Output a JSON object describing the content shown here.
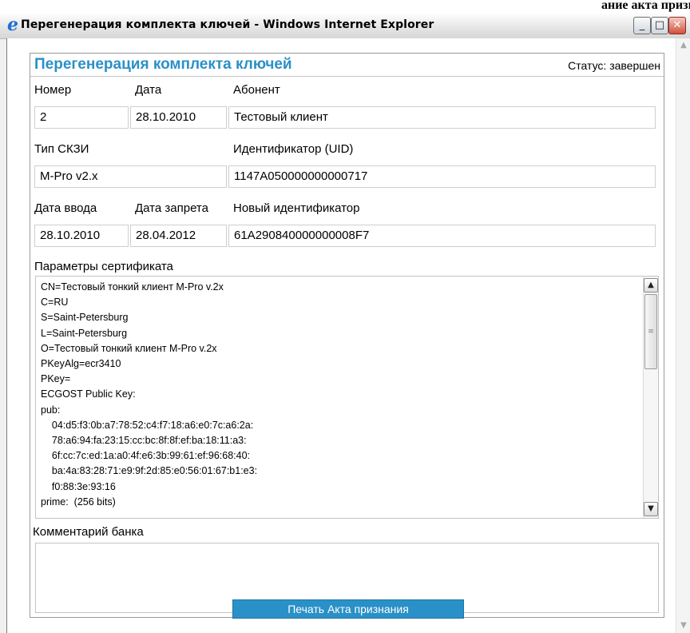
{
  "background": {
    "text_left": "...",
    "text_right": "ание акта признан"
  },
  "window": {
    "title": "Перегенерация комплекта ключей - Windows Internet Explorer",
    "browser_logo": "e",
    "minimize_label": "_",
    "maximize_label": "□",
    "close_label": "✕",
    "scroll_up": "▲",
    "scroll_down": "▼"
  },
  "panel": {
    "title": "Перегенерация комплекта ключей",
    "status": "Статус: завершен"
  },
  "form": {
    "number_label": "Номер",
    "number_value": "2",
    "date_label": "Дата",
    "date_value": "28.10.2010",
    "subscriber_label": "Абонент",
    "subscriber_value": "Тестовый клиент",
    "skzi_label": "Тип СКЗИ",
    "skzi_value": "M-Pro v2.x",
    "uid_label": "Идентификатор (UID)",
    "uid_value": "1147A050000000000717",
    "input_date_label": "Дата ввода",
    "input_date_value": "28.10.2010",
    "ban_date_label": "Дата запрета",
    "ban_date_value": "28.04.2012",
    "new_id_label": "Новый идентификатор",
    "new_id_value": "61A290840000000008F7"
  },
  "certificate": {
    "label": "Параметры сертификата",
    "lines": [
      "CN=Тестовый тонкий клиент M-Pro v.2x",
      "C=RU",
      "S=Saint-Petersburg",
      "L=Saint-Petersburg",
      "O=Тестовый тонкий клиент M-Pro v.2x",
      "PKeyAlg=ecr3410",
      "PKey=",
      "ECGOST Public Key:",
      "pub:",
      "    04:d5:f3:0b:a7:78:52:c4:f7:18:a6:e0:7c:a6:2a:",
      "    78:a6:94:fa:23:15:cc:bc:8f:8f:ef:ba:18:11:a3:",
      "    6f:cc:7c:ed:1a:a0:4f:e6:3b:99:61:ef:96:68:40:",
      "    ba:4a:83:28:71:e9:9f:2d:85:e0:56:01:67:b1:e3:",
      "    f0:88:3e:93:16",
      "prime:  (256 bits)"
    ],
    "scroll_up": "▲",
    "scroll_down": "▼",
    "thumb_grip": "≡"
  },
  "comment": {
    "label": "Комментарий банка",
    "value": ""
  },
  "actions": {
    "print_label": "Печать Акта признания"
  }
}
